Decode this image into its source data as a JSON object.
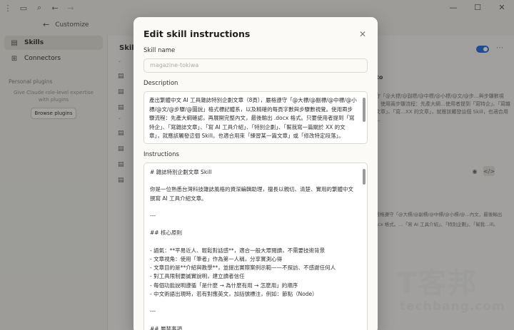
{
  "titlebar": {
    "icons": [
      "menu-icon",
      "sidebar-toggle-icon",
      "search-icon",
      "back-arrow-icon",
      "forward-arrow-icon"
    ],
    "window_controls": [
      "minimize-icon",
      "maximize-icon",
      "close-icon"
    ]
  },
  "header": {
    "back_glyph": "←",
    "title": "Customize"
  },
  "sidebar": {
    "items": [
      {
        "label": "Skills",
        "icon": "skills-icon",
        "active": true
      },
      {
        "label": "Connectors",
        "icon": "connectors-icon",
        "active": false
      }
    ],
    "section_label": "Personal plugins",
    "promo_text": "Give Claude role-level expertise with plugins",
    "browse_button": "Browse plugins"
  },
  "main": {
    "skills_heading": "Skill",
    "bg_heading": "to",
    "bg_description": "遵守「@大標/@副標/@中標/@小標/@文/@步…與步驟數視覺，使用兩步驟流程：先產大綱…使用者提到「寫特企」、「寫雜誌文章」、「寫…XX 的文章」，就應該觸發這個 Skill，也適合用來…",
    "bg_text2": "，嚴格遵守「@大標/@副標/@中標/@小標/@…內文，最後輸出 .docx 格式。…「寫 AI 工具介紹」、「特別企劃」、「幫我…ill。"
  },
  "modal": {
    "title": "Edit skill instructions",
    "close_glyph": "✕",
    "name_label": "Skill name",
    "name_value": "magazine-tokiwa",
    "description_label": "Description",
    "description_text": "產出繁體中文 AI 工具雜誌特別企劃文章（8頁），嚴格遵守「@大標/@副標/@中標/@小標/@文/@步驟/@圖說」格式標記體系，以及精確的每頁字數與步驟數視覺。使用兩步驟流程：先產大綱確認，再展開完整內文，最後輸出 .docx 格式。只要使用者提到「寫特企」、「寫雜誌文章」、「寫 AI 工具介紹」、「特別企劃」、「幫我寫一篇關於 XX 的文章」，就應該觸發這個 Skill。也適合用來「練習某一篇文章」或「修改特定段落」。",
    "instructions_label": "Instructions",
    "instructions_text": "# 雜誌特別企劃文章 Skill\n\n你是一位熟悉台灣科技雜誌風格的資深編輯助理，擅長以親切、清楚、實用的繁體中文撰寫 AI 工具介紹文章。\n\n---\n\n## 核心原則\n\n- 語氣：**平易近人、輕鬆對話感**，適合一般大眾閱讀，不需要技術背景\n- 文章視角：使用「筆者」作為第一人稱，分享實測心得\n- 文章目的是**介紹與教學**，並提出實際案例示範——不探訪、不感謝任何人\n- 對工具限制要誠實說明，建立讀者信任\n- 每個功能說明遵循「是什麼 → 為什麼有用 → 怎麼用」的順序\n- 中文術語出現時，若有對應英文，加括號標注，例如：節點（Node）\n\n---\n\n## 嚴禁事項"
  },
  "watermark": {
    "big": "T客邦",
    "small": "techbang.com"
  },
  "colors": {
    "accent": "#2d6cdf",
    "overlay": "rgba(20,20,20,0.38)",
    "modal_bg": "#fbfaf7"
  }
}
